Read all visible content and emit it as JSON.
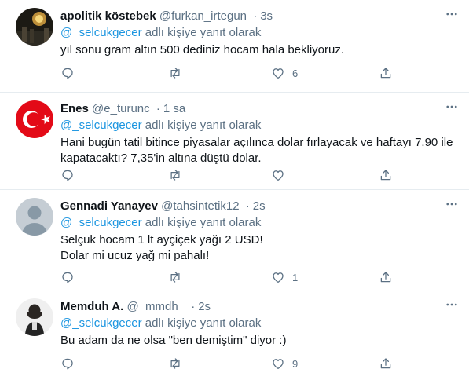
{
  "replying_suffix": " adlı kişiye yanıt olarak",
  "tweets": [
    {
      "name": "apolitik köstebek",
      "handle": "@furkan_irtegun",
      "separator": "·",
      "time": "3s",
      "reply_to": "@_selcukgecer",
      "text": "yıl sonu gram altın 500 dediniz hocam hala bekliyoruz.",
      "reply_count": "",
      "retweet_count": "",
      "like_count": "6",
      "avatar_icon": "night-crowd-avatar"
    },
    {
      "name": "Enes",
      "handle": "@e_turunc",
      "separator": "·",
      "time": "1 sa",
      "reply_to": "@_selcukgecer",
      "text": "Hani bugün tatil bitince piyasalar açılınca dolar fırlayacak ve haftayı 7.90 ile kapatacaktı? 7,35'in altına düştü dolar.",
      "reply_count": "",
      "retweet_count": "",
      "like_count": "",
      "avatar_icon": "turkish-flag-avatar"
    },
    {
      "name": "Gennadi Yanayev",
      "handle": "@tahsintetik12",
      "separator": "·",
      "time": "2s",
      "reply_to": "@_selcukgecer",
      "text": "Selçuk hocam 1 lt ayçiçek yağı 2 USD!\nDolar mi ucuz yağ mi pahalı!",
      "reply_count": "",
      "retweet_count": "",
      "like_count": "1",
      "avatar_icon": "default-profile-avatar"
    },
    {
      "name": "Memduh A.",
      "handle": "@_mmdh_",
      "separator": "·",
      "time": "2s",
      "reply_to": "@_selcukgecer",
      "text": "Bu adam da ne olsa \"ben demiştim\" diyor :)",
      "reply_count": "",
      "retweet_count": "",
      "like_count": "9",
      "avatar_icon": "person-photo-avatar"
    }
  ],
  "colors": {
    "text": "#0f1419",
    "secondary": "#5b7083",
    "mention": "#1b95e0",
    "divider": "#e6ecf0",
    "flag_red": "#e30a17"
  }
}
